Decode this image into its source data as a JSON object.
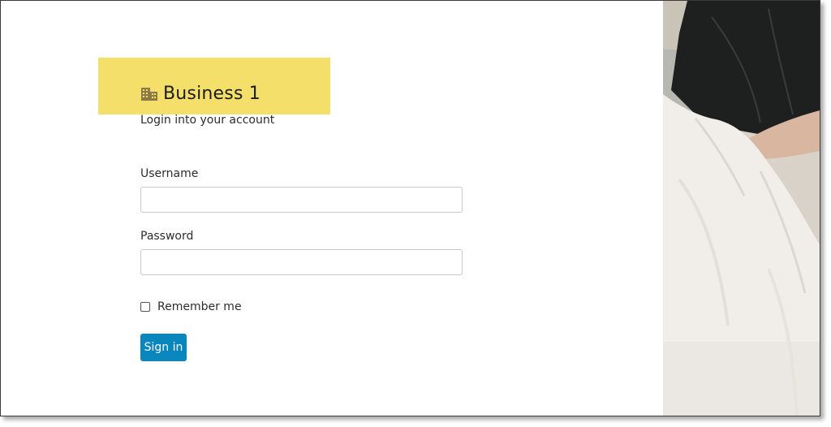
{
  "brand": {
    "name": "Business 1",
    "icon": "building-icon"
  },
  "login": {
    "subtitle": "Login into your account",
    "username_label": "Username",
    "username_value": "",
    "password_label": "Password",
    "password_value": "",
    "remember_label": "Remember me",
    "remember_checked": false,
    "signin_label": "Sign in"
  },
  "colors": {
    "highlight": "#f4df6a",
    "button": "#0a86bf",
    "icon": "#8b7a45"
  }
}
